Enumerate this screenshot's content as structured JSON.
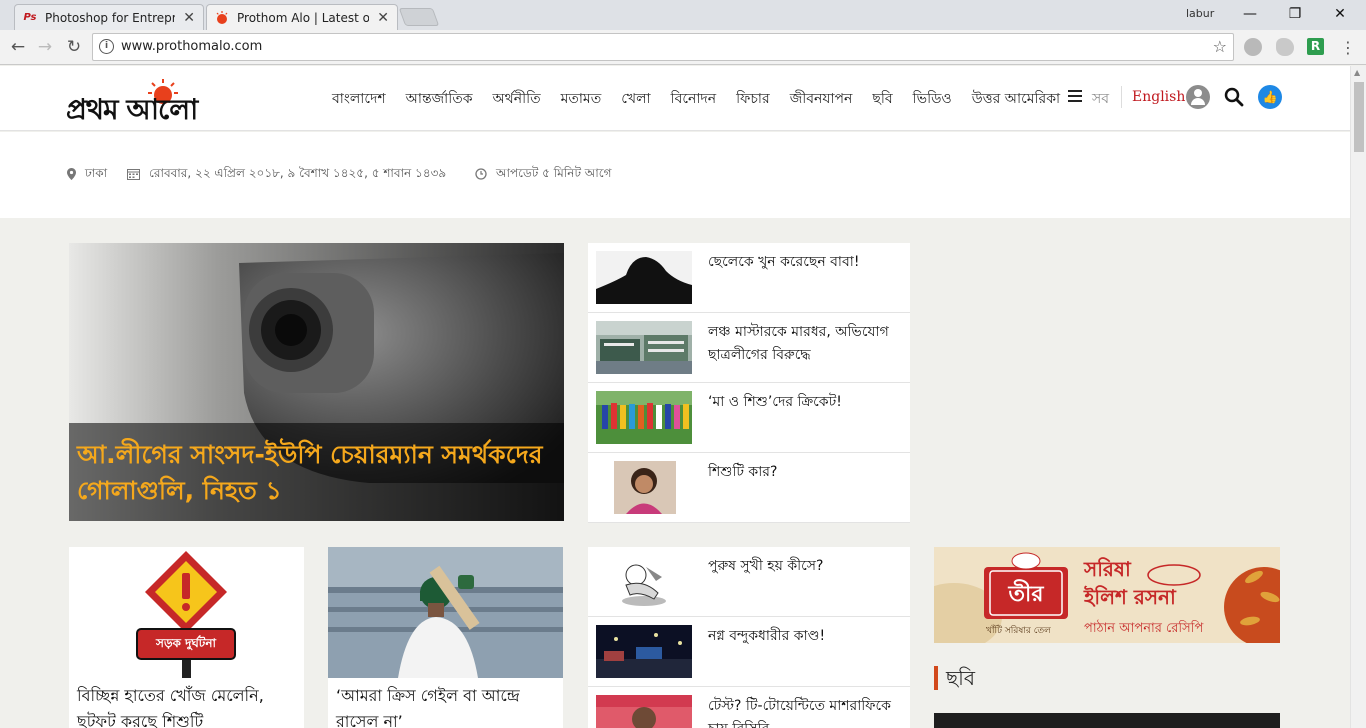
{
  "browser": {
    "tabs": [
      {
        "title": "Photoshop for Entrepren",
        "close": "✕",
        "favicon": "Ps"
      },
      {
        "title": "Prothom Alo | Latest onli",
        "close": "✕",
        "favicon": "alo"
      }
    ],
    "profile_name": "labur",
    "window_buttons": {
      "minimize": "—",
      "maximize": "❐",
      "close": "✕"
    },
    "nav": {
      "back": "←",
      "forward": "→",
      "reload": "↻"
    },
    "url": "www.prothomalo.com",
    "info_glyph": "i",
    "bookmark_glyph": "☆",
    "extension_r": "R",
    "menu_glyph": "⋮"
  },
  "site": {
    "logo_text": "প্রথম আলো",
    "nav_items": [
      "বাংলাদেশ",
      "আন্তর্জাতিক",
      "অর্থনীতি",
      "মতামত",
      "খেলা",
      "বিনোদন",
      "ফিচার",
      "জীবনযাপন",
      "ছবি",
      "ভিডিও",
      "উত্তর আমেরিকা"
    ],
    "all_label": "সব",
    "english_label": "English",
    "like_glyph": "👍"
  },
  "infobar": {
    "location": "ঢাকা",
    "date": "রোববার, ২২ এপ্রিল ২০১৮, ৯ বৈশাখ ১৪২৫, ৫ শাবান ১৪৩৯",
    "updated": "আপডেট ৫ মিনিট আগে"
  },
  "lead_story": {
    "headline": "আ.লীগের সাংসদ-ইউপি চেয়ারম্যান সমর্থকদের গোলাগুলি, নিহত ১"
  },
  "side_stories": [
    {
      "headline": "ছেলেকে খুন করেছেন বাবা!"
    },
    {
      "headline": "লঞ্চ মাস্টারকে মারধর, অভিযোগ ছাত্রলীগের বিরুদ্ধে"
    },
    {
      "headline": "‘মা ও শিশু’দের ক্রিকেট!"
    },
    {
      "headline": "শিশুটি কার?"
    }
  ],
  "side_stories_2": [
    {
      "headline": "পুরুষ সুখী হয় কীসে?"
    },
    {
      "headline": "নগ্ন বন্দুকধারীর কাণ্ড!"
    },
    {
      "headline": "টেস্ট? টি-টোয়েন্টিতে মাশরাফিকে চায় বিসিবি"
    }
  ],
  "cards": [
    {
      "headline": "বিচ্ছিন্ন হাতের খোঁজ মেলেনি, ছটফট করছে শিশুটি",
      "sign_text": "সড়ক দুর্ঘটনা"
    },
    {
      "headline": "‘আমরা ক্রিস গেইল বা আন্দ্রে রাসেল না’"
    }
  ],
  "ad": {
    "brand": "তীর",
    "title_line1": "সরিষা",
    "title_line2": "ইলিশ রসনা",
    "subline": "পাঠান আপনার রেসিপি",
    "tagline": "খাঁটি সরিষার তেল"
  },
  "section": {
    "title": "ছবি"
  },
  "colors": {
    "brand_red": "#c0181e",
    "lead_headline": "#f5a81c",
    "accent_orange": "#d2491b",
    "like_blue": "#1e88e5"
  }
}
